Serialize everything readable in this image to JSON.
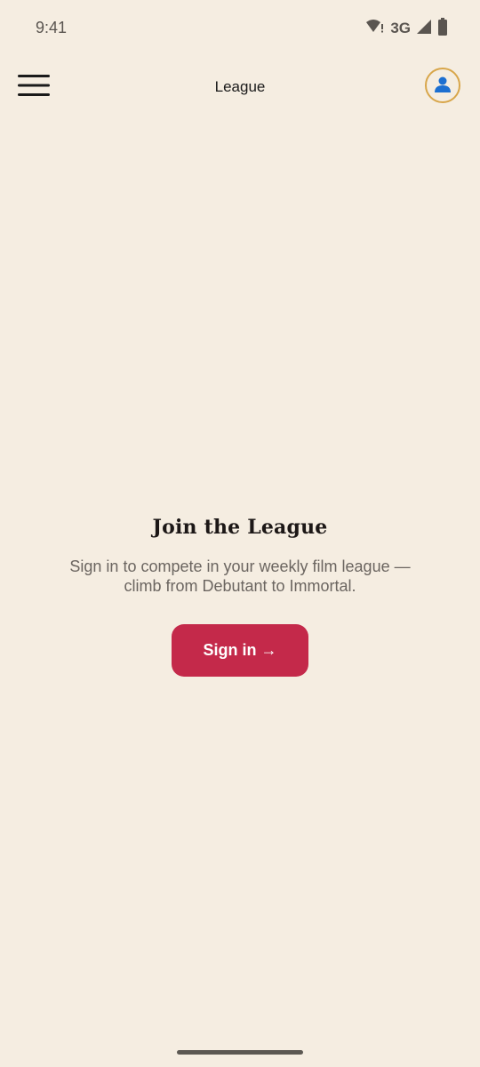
{
  "status_bar": {
    "time": "9:41",
    "network": "3G",
    "icons": [
      "wifi-alert-icon",
      "signal-icon",
      "battery-icon"
    ]
  },
  "app_bar": {
    "title": "League",
    "menu_icon": "hamburger-menu-icon",
    "profile_icon": "person-icon"
  },
  "join": {
    "title": "Join the League",
    "subtitle": "Sign in to compete in your weekly film league — climb from Debutant to Immortal.",
    "sign_in_label": "Sign in →"
  },
  "colors": {
    "background": "#f5ede1",
    "accent": "#c4294a",
    "profile_ring": "#d8a64a",
    "profile_icon": "#1c6fd1"
  }
}
